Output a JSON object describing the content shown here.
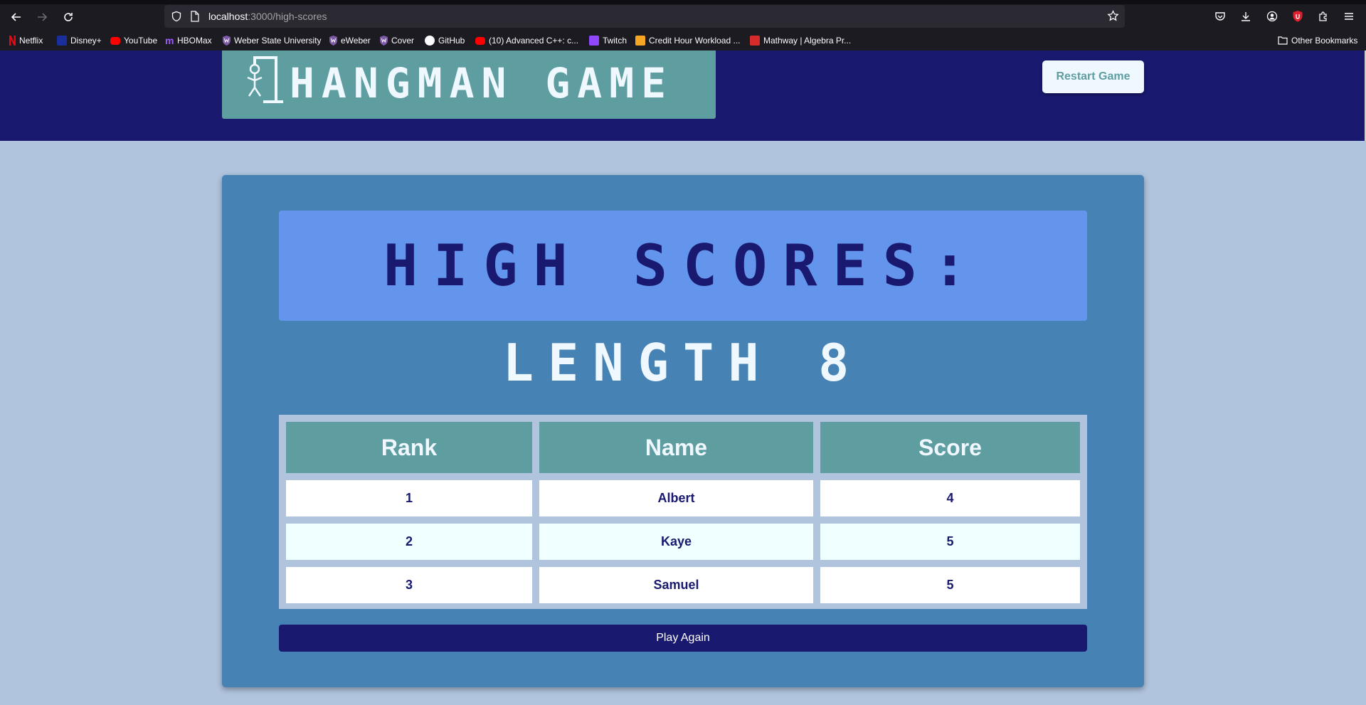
{
  "browser": {
    "url_host": "localhost",
    "url_path": ":3000/high-scores",
    "bookmarks": [
      {
        "label": "Netflix",
        "color": "#e50914"
      },
      {
        "label": "Disney+",
        "color": "#1a2f9c"
      },
      {
        "label": "YouTube",
        "color": "#ff0000"
      },
      {
        "label": "HBOMax",
        "color": "#7b2ff7"
      },
      {
        "label": "Weber State University",
        "color": "#4b2e83"
      },
      {
        "label": "eWeber",
        "color": "#4b2e83"
      },
      {
        "label": "Cover",
        "color": "#4b2e83"
      },
      {
        "label": "GitHub",
        "color": "#ffffff"
      },
      {
        "label": "(10) Advanced C++: c...",
        "color": "#ff0000"
      },
      {
        "label": "Twitch",
        "color": "#9146ff"
      },
      {
        "label": "Credit Hour Workload ...",
        "color": "#f5a623"
      },
      {
        "label": "Mathway | Algebra Pr...",
        "color": "#d62b2b"
      }
    ],
    "other_bookmarks": "Other Bookmarks"
  },
  "header": {
    "logo_text": "HANGMAN GAME",
    "restart_label": "Restart Game"
  },
  "main": {
    "title": "HIGH SCORES:",
    "subtitle": "LENGTH 8",
    "table": {
      "headers": [
        "Rank",
        "Name",
        "Score"
      ],
      "rows": [
        [
          "1",
          "Albert",
          "4"
        ],
        [
          "2",
          "Kaye",
          "5"
        ],
        [
          "3",
          "Samuel",
          "5"
        ]
      ]
    },
    "play_again_label": "Play Again"
  },
  "colors": {
    "navy": "#191970",
    "cadet_blue": "#5f9ea0",
    "steel_blue": "#4682b4",
    "cornflower": "#6495ed",
    "light_steel_blue": "#b0c4de",
    "alice_blue": "#f0f8ff"
  }
}
